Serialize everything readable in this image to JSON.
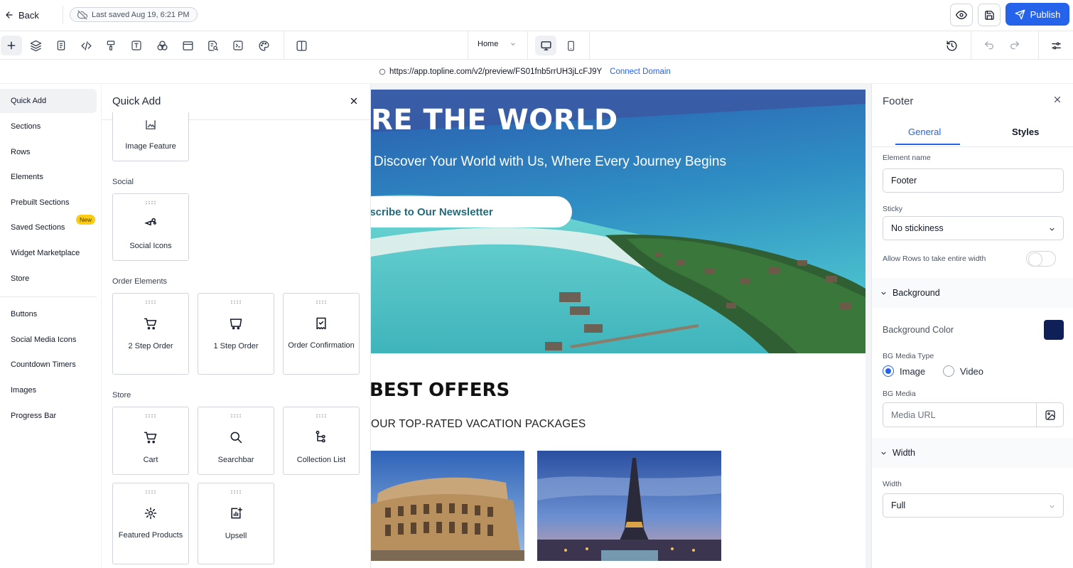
{
  "topbar": {
    "back_label": "Back",
    "saved_status": "Last saved Aug 19, 6:21 PM",
    "publish_label": "Publish"
  },
  "toolbar": {
    "tools": [
      "add-icon",
      "layers-icon",
      "page-icon",
      "code-icon",
      "paint-icon",
      "text-icon",
      "shapes-icon",
      "window-icon",
      "seo-icon",
      "terminal-icon",
      "palette-icon",
      "columns-icon"
    ],
    "page_select": "Home",
    "devices": [
      "desktop-icon",
      "mobile-icon"
    ]
  },
  "preview": {
    "url": "https://app.topline.com/v2/preview/FS01fnb5rrUH3jLcFJ9Y",
    "connect_label": "Connect Domain"
  },
  "left_nav": {
    "items": [
      "Quick Add",
      "Sections",
      "Rows",
      "Elements",
      "Prebuilt Sections",
      "Saved Sections",
      "Widget Marketplace",
      "Store",
      "Buttons",
      "Social Media Icons",
      "Countdown Timers",
      "Images",
      "Progress Bar"
    ],
    "new_badge": "New"
  },
  "quick_add": {
    "title": "Quick Add",
    "image_feature": "Image Feature",
    "social_label": "Social",
    "social_icons": "Social Icons",
    "order_label": "Order Elements",
    "order_items": [
      "2 Step Order",
      "1 Step Order",
      "Order Confirmation"
    ],
    "store_label": "Store",
    "store_items": [
      "Cart",
      "Searchbar",
      "Collection List",
      "Featured Products",
      "Upsell"
    ]
  },
  "canvas": {
    "hero_title": "RE THE WORLD",
    "hero_subtitle": "Discover Your World with Us, Where Every Journey Begins",
    "hero_button": "Subscribe to Our Newsletter",
    "offers_title": "BEST OFFERS",
    "offers_subtitle": "OUR TOP-RATED VACATION PACKAGES"
  },
  "right_panel": {
    "title": "Footer",
    "tabs": [
      "General",
      "Styles"
    ],
    "element_name_label": "Element name",
    "element_name_value": "Footer",
    "sticky_label": "Sticky",
    "sticky_value": "No stickiness",
    "allow_rows_label": "Allow Rows to take entire width",
    "allow_rows_enabled": false,
    "background_section": "Background",
    "bg_color_label": "Background Color",
    "bg_color_value": "#0f1f57",
    "bg_media_type_label": "BG Media Type",
    "media_types": [
      "Image",
      "Video"
    ],
    "media_type_selected": "Image",
    "bg_media_label": "BG Media",
    "bg_media_placeholder": "Media URL",
    "width_section": "Width",
    "width_label": "Width",
    "width_value": "Full"
  },
  "colors": {
    "accent": "#2563eb",
    "badge": "#facc15",
    "hero_button_text": "#226a7a"
  }
}
